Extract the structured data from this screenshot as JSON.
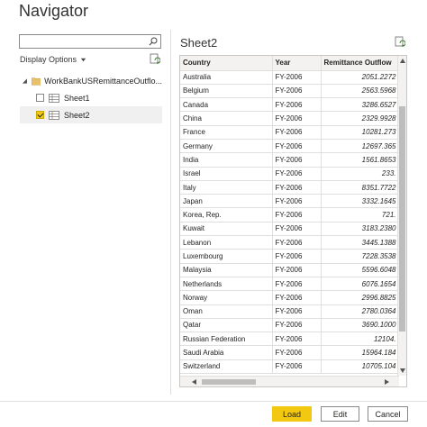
{
  "window": {
    "title": "Navigator"
  },
  "left_panel": {
    "search": {
      "value": "",
      "placeholder": ""
    },
    "display_options_label": "Display Options",
    "tree": {
      "root": {
        "label": "WorkBankUSRemittanceOutflo..."
      },
      "items": [
        {
          "label": "Sheet1",
          "checked": false
        },
        {
          "label": "Sheet2",
          "checked": true
        }
      ]
    }
  },
  "preview": {
    "title": "Sheet2",
    "columns": [
      "Country",
      "Year",
      "Remittance Outflow"
    ],
    "rows": [
      [
        "Australia",
        "FY-2006",
        "2051.2272"
      ],
      [
        "Belgium",
        "FY-2006",
        "2563.5968"
      ],
      [
        "Canada",
        "FY-2006",
        "3286.6527"
      ],
      [
        "China",
        "FY-2006",
        "2329.9928"
      ],
      [
        "France",
        "FY-2006",
        "10281.273"
      ],
      [
        "Germany",
        "FY-2006",
        "12697.365"
      ],
      [
        "India",
        "FY-2006",
        "1561.8653"
      ],
      [
        "Israel",
        "FY-2006",
        "233."
      ],
      [
        "Italy",
        "FY-2006",
        "8351.7722"
      ],
      [
        "Japan",
        "FY-2006",
        "3332.1645"
      ],
      [
        "Korea, Rep.",
        "FY-2006",
        "721."
      ],
      [
        "Kuwait",
        "FY-2006",
        "3183.2380"
      ],
      [
        "Lebanon",
        "FY-2006",
        "3445.1388"
      ],
      [
        "Luxembourg",
        "FY-2006",
        "7228.3538"
      ],
      [
        "Malaysia",
        "FY-2006",
        "5596.6048"
      ],
      [
        "Netherlands",
        "FY-2006",
        "6076.1654"
      ],
      [
        "Norway",
        "FY-2006",
        "2996.8825"
      ],
      [
        "Oman",
        "FY-2006",
        "2780.0364"
      ],
      [
        "Qatar",
        "FY-2006",
        "3690.1000"
      ],
      [
        "Russian Federation",
        "FY-2006",
        "12104."
      ],
      [
        "Saudi Arabia",
        "FY-2006",
        "15964.184"
      ],
      [
        "Switzerland",
        "FY-2006",
        "10705.104"
      ]
    ]
  },
  "footer": {
    "load_label": "Load",
    "edit_label": "Edit",
    "cancel_label": "Cancel"
  },
  "colors": {
    "accent": "#f2c811",
    "header_bg": "#f3f2f1",
    "selected_bg": "#f0f0f0"
  }
}
